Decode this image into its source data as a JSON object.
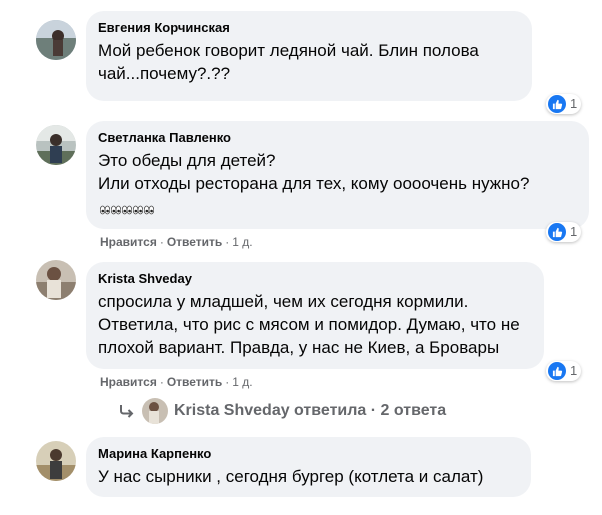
{
  "comments": [
    {
      "author": "Евгения Корчинская",
      "lines": [
        "Мой ребенок говорит ледяной чай. Блин полова",
        "чай...почему?.??"
      ],
      "reactions": "1"
    },
    {
      "author": "Светланка Павленко",
      "lines": [
        "Это обеды для детей?",
        "Или отходы ресторана для тех, кому оооочень нужно?"
      ],
      "emoji": "👀👀👀👀👀",
      "like_label": "Нравится",
      "reply_label": "Ответить",
      "time": "1 д.",
      "reactions": "1"
    },
    {
      "author": "Krista Shveday",
      "lines": [
        "спросила у младшей, чем их сегодня кормили.",
        "Ответила, что рис с мясом и помидор. Думаю, что не",
        "плохой вариант. Правда, у нас не Киев, а Бровары"
      ],
      "like_label": "Нравится",
      "reply_label": "Ответить",
      "time": "1 д.",
      "reactions": "1",
      "replies_summary": "Krista Shveday ответила · 2 ответа"
    },
    {
      "author": "Марина Карпенко",
      "lines": [
        "У нас сырники , сегодня бургер (котлета и салат)"
      ]
    }
  ],
  "separator": "·",
  "colors": {
    "bubble": "#f0f2f5",
    "secondary_text": "#65676b",
    "like_blue": "#1877f2"
  }
}
